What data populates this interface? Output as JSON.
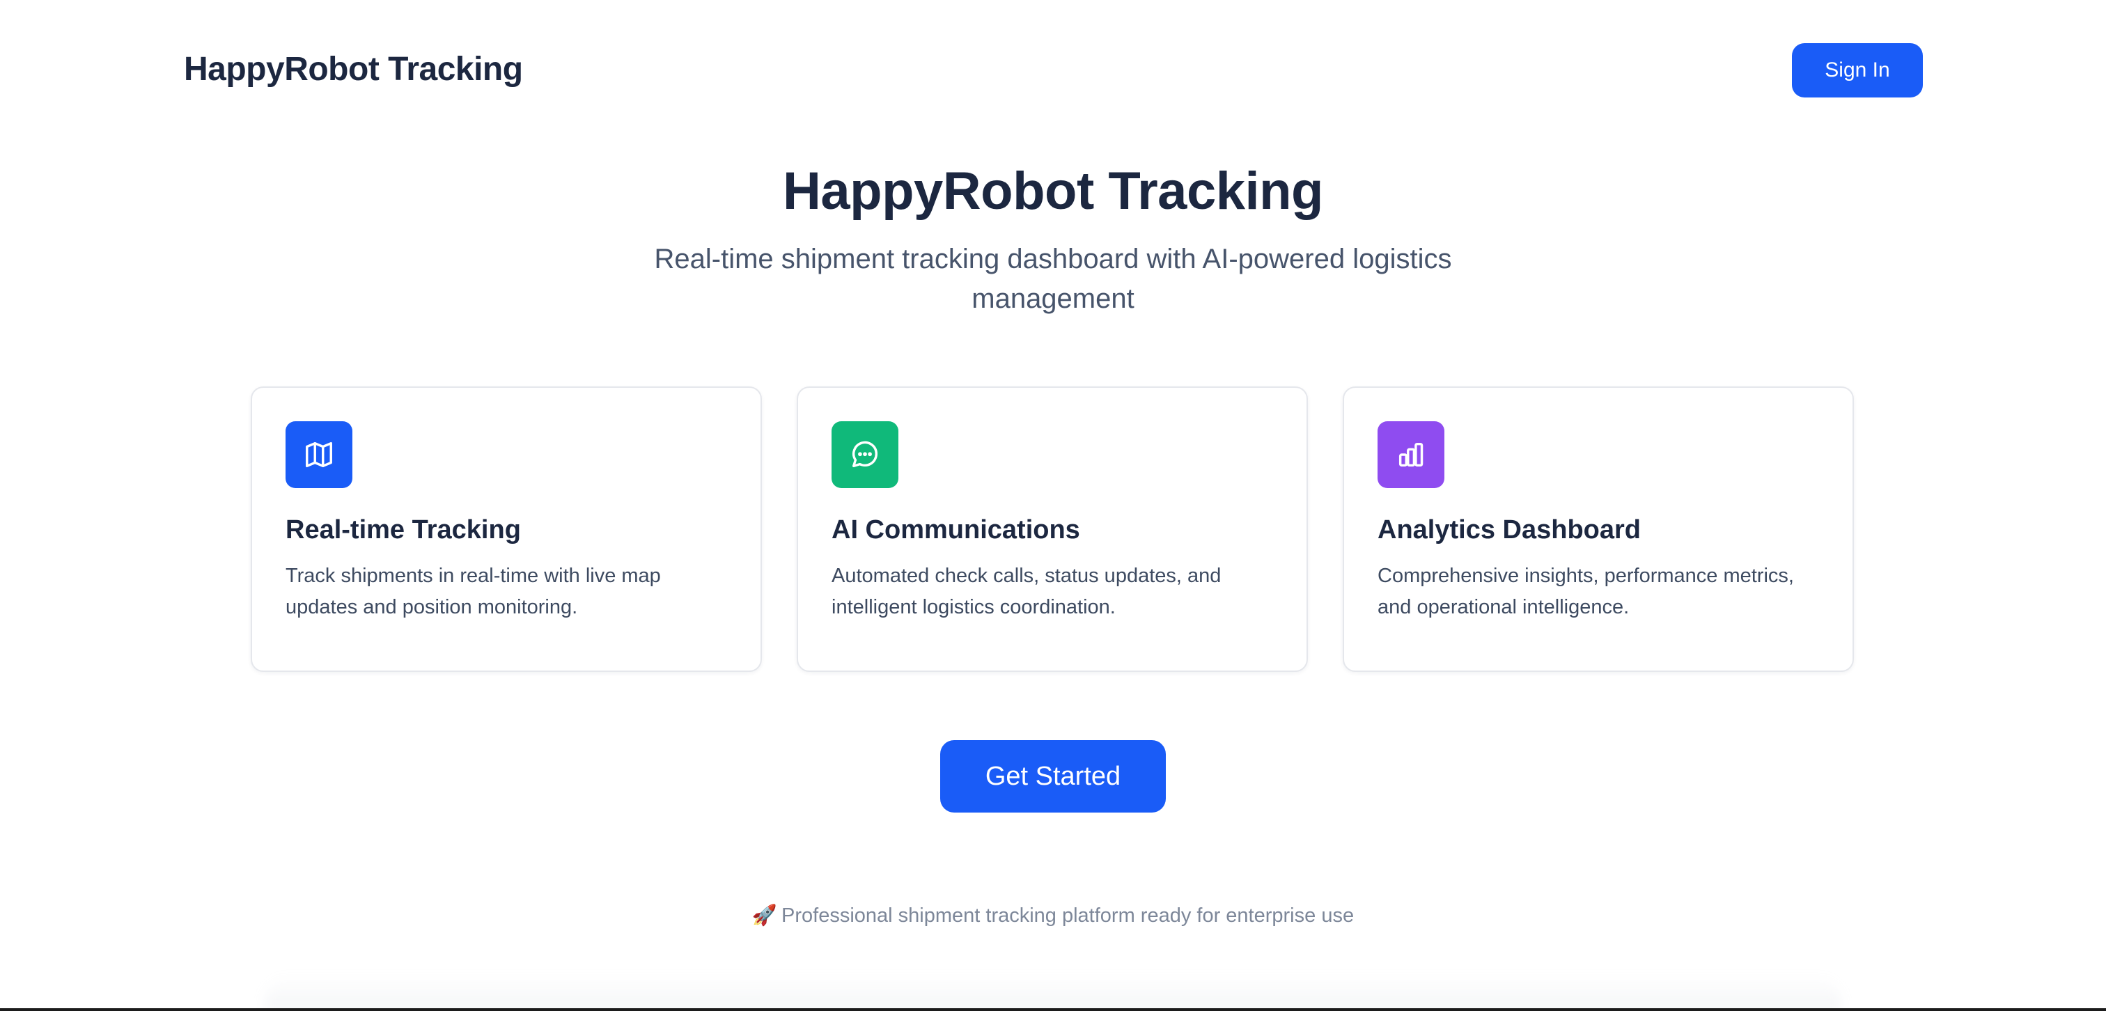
{
  "header": {
    "brand": "HappyRobot Tracking",
    "sign_in_label": "Sign In"
  },
  "hero": {
    "title": "HappyRobot Tracking",
    "subtitle": "Real-time shipment tracking dashboard with AI-powered logistics management"
  },
  "features": [
    {
      "icon": "map-icon",
      "icon_color": "#1a5cf7",
      "title": "Real-time Tracking",
      "description": "Track shipments in real-time with live map updates and position monitoring."
    },
    {
      "icon": "message-circle-icon",
      "icon_color": "#10b97a",
      "title": "AI Communications",
      "description": "Automated check calls, status updates, and intelligent logistics coordination."
    },
    {
      "icon": "bar-chart-icon",
      "icon_color": "#8f4cf0",
      "title": "Analytics Dashboard",
      "description": "Comprehensive insights, performance metrics, and operational intelligence."
    }
  ],
  "cta": {
    "label": "Get Started"
  },
  "footer": {
    "emoji": "🚀",
    "note": "Professional shipment tracking platform ready for enterprise use"
  },
  "colors": {
    "accent": "#1a5cf7",
    "text_primary": "#1c2740",
    "text_secondary": "#47546b",
    "text_muted": "#7d8799"
  }
}
